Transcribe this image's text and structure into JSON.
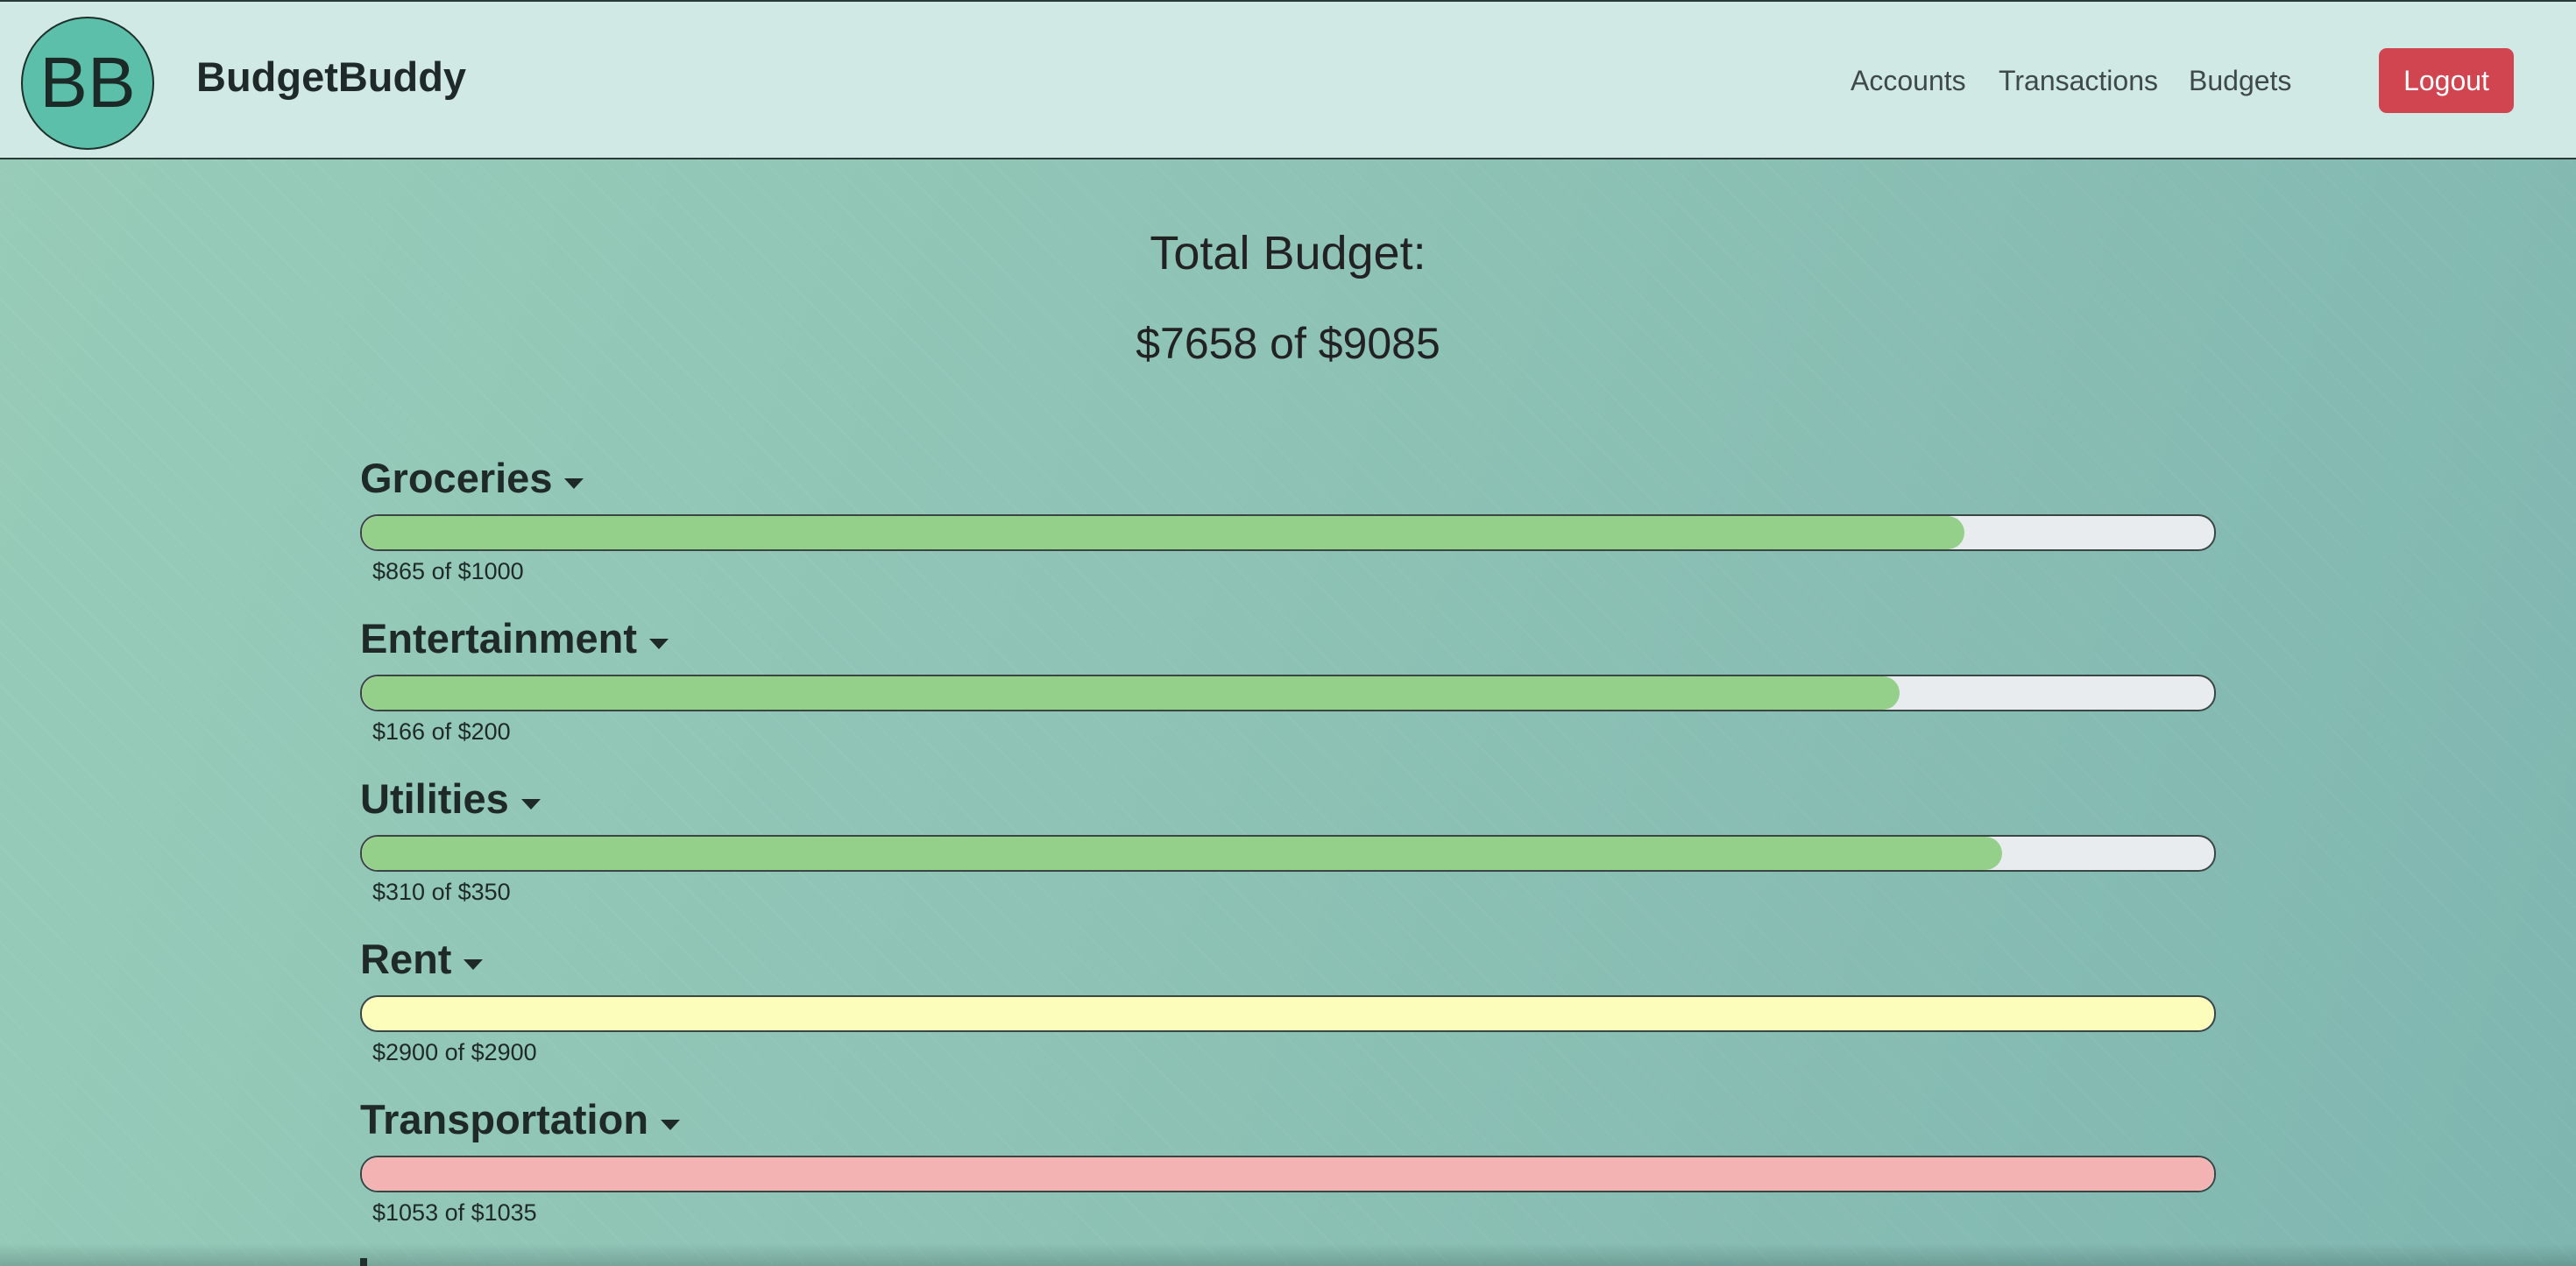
{
  "app": {
    "logo_text": "BB",
    "brand": "BudgetBuddy"
  },
  "nav": {
    "accounts": "Accounts",
    "transactions": "Transactions",
    "budgets": "Budgets",
    "logout": "Logout"
  },
  "total": {
    "title": "Total Budget:",
    "amount": "$7658 of $9085"
  },
  "budgets": [
    {
      "name": "Groceries",
      "amount_text": "$865 of $1000",
      "spent": 865,
      "limit": 1000,
      "status_color": "#95d08b"
    },
    {
      "name": "Entertainment",
      "amount_text": "$166 of $200",
      "spent": 166,
      "limit": 200,
      "status_color": "#95d08b"
    },
    {
      "name": "Utilities",
      "amount_text": "$310 of $350",
      "spent": 310,
      "limit": 350,
      "status_color": "#95d08b"
    },
    {
      "name": "Rent",
      "amount_text": "$2900 of $2900",
      "spent": 2900,
      "limit": 2900,
      "status_color": "#fdfdbb"
    },
    {
      "name": "Transportation",
      "amount_text": "$1053 of $1035",
      "spent": 1053,
      "limit": 1035,
      "status_color": "#f4b3b3"
    }
  ],
  "colors": {
    "navbar_bg": "#d0e9e4",
    "logo_bg": "#5cbfa9",
    "logout_bg": "#d04550",
    "bar_track": "#e9ecef"
  },
  "icons": {
    "dropdown": "caret-down-icon"
  }
}
